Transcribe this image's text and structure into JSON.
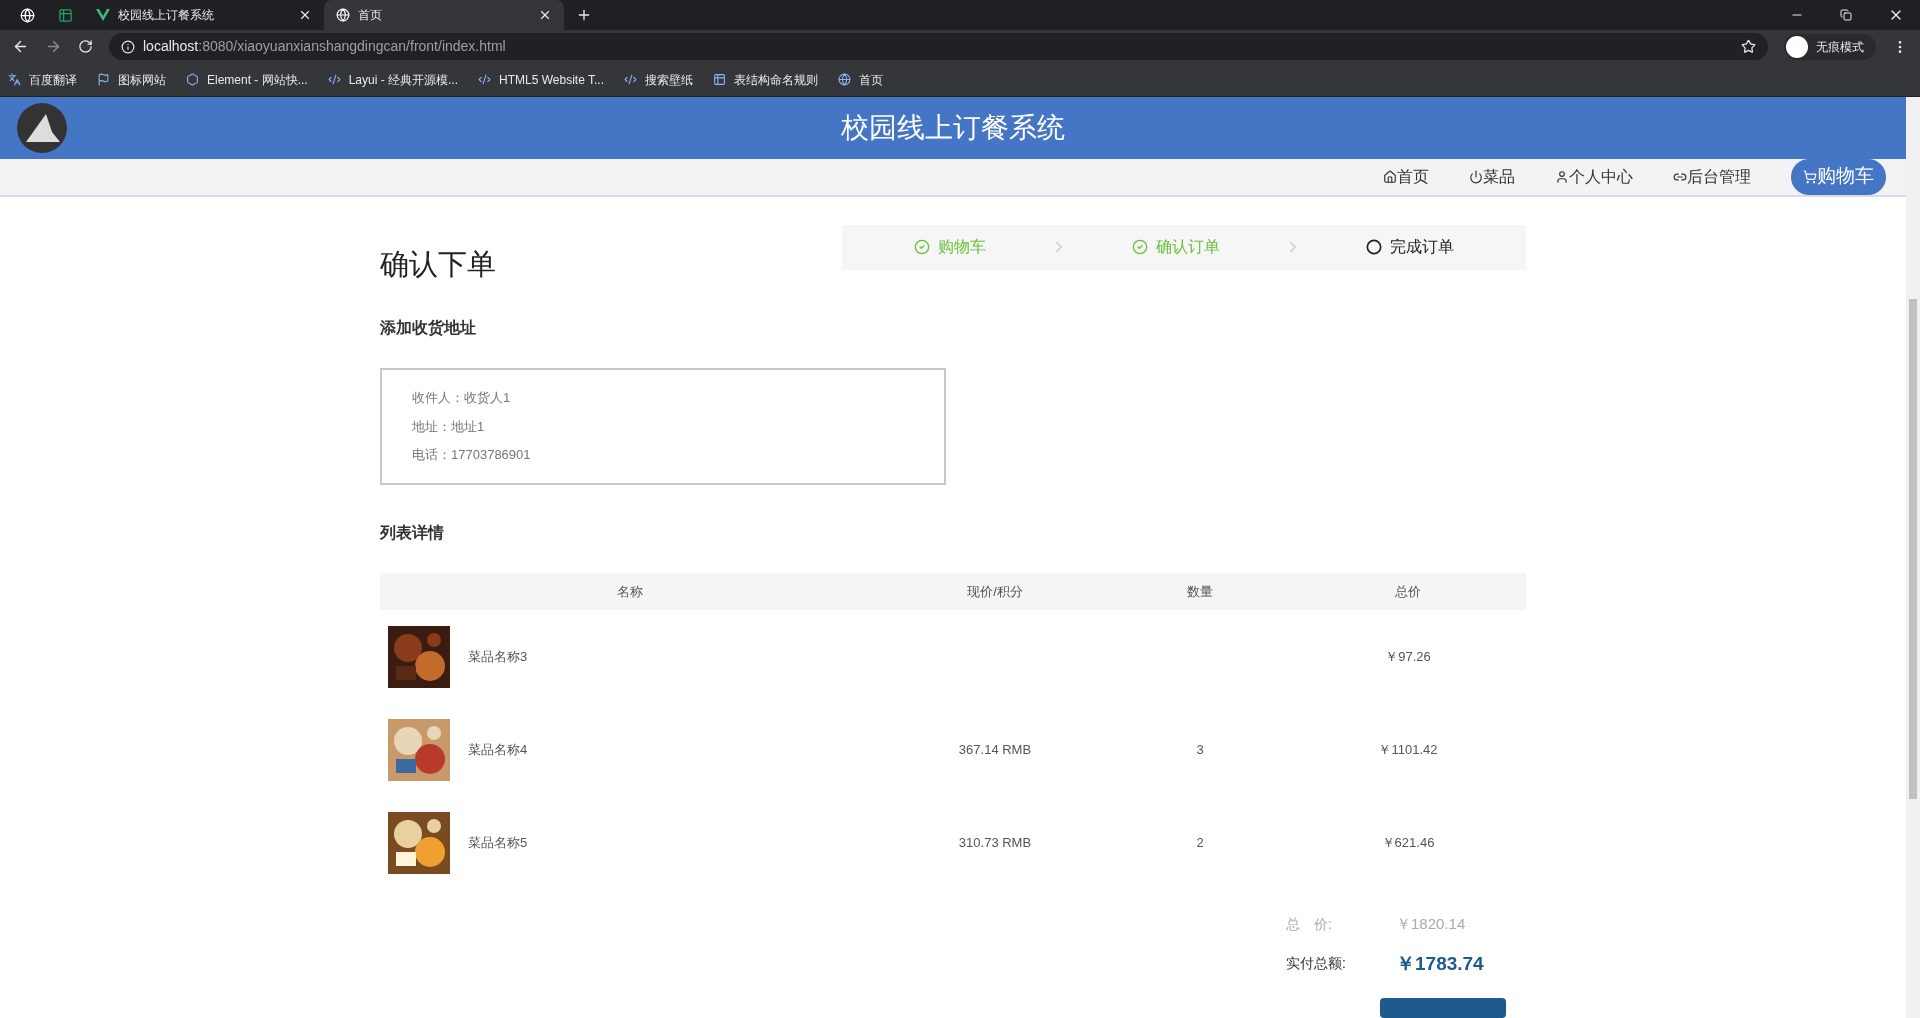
{
  "browser": {
    "tabs": [
      {
        "kind": "pinned",
        "selected": false
      },
      {
        "kind": "pinned-sheet",
        "selected": false
      },
      {
        "kind": "vue",
        "title": "校园线上订餐系统",
        "selected": false
      },
      {
        "kind": "globe",
        "title": "首页",
        "selected": true
      }
    ],
    "url_host": "localhost",
    "url_rest": ":8080/xiaoyuanxianshangdingcan/front/index.html",
    "profile": "无痕模式",
    "bookmarks": [
      {
        "kind": "translate",
        "label": "百度翻译"
      },
      {
        "kind": "flag",
        "label": "图标网站"
      },
      {
        "kind": "hex",
        "label": "Element - 网站快..."
      },
      {
        "kind": "layui",
        "label": "Layui - 经典开源模..."
      },
      {
        "kind": "html5",
        "label": "HTML5 Website T..."
      },
      {
        "kind": "wallpaper",
        "label": "搜索壁纸"
      },
      {
        "kind": "sheet",
        "label": "表结构命名规则"
      },
      {
        "kind": "globe",
        "label": "首页"
      }
    ]
  },
  "header": {
    "title": "校园线上订餐系统"
  },
  "nav": [
    {
      "kind": "home",
      "label": "首页",
      "selected": false
    },
    {
      "kind": "power",
      "label": "菜品",
      "selected": false
    },
    {
      "kind": "user",
      "label": "个人中心",
      "selected": false
    },
    {
      "kind": "link",
      "label": "后台管理",
      "selected": false
    },
    {
      "kind": "cart",
      "label": "购物车",
      "selected": true
    }
  ],
  "page_title": "确认下单",
  "steps": [
    {
      "label": "购物车",
      "done": true
    },
    {
      "label": "确认订单",
      "done": true
    },
    {
      "label": "完成订单",
      "done": false
    }
  ],
  "address_heading": "添加收货地址",
  "address": [
    "收件人：收货人1",
    "地址：地址1",
    "电话：17703786901"
  ],
  "list_heading": "列表详情",
  "table": {
    "columns": [
      "名称",
      "现价/积分",
      "数量",
      "总价"
    ],
    "rows": [
      {
        "name": "菜品名称3",
        "total": "￥97.26"
      },
      {
        "name": "菜品名称4",
        "price": "367.14 RMB",
        "qty": "3",
        "total": "￥1101.42"
      },
      {
        "name": "菜品名称5",
        "price": "310.73 RMB",
        "qty": "2",
        "total": "￥621.46"
      }
    ]
  },
  "totals": {
    "total_label": "总　价:",
    "total": "￥1820.14",
    "paid_label": "实付总额:",
    "paid": "￥1783.74"
  }
}
